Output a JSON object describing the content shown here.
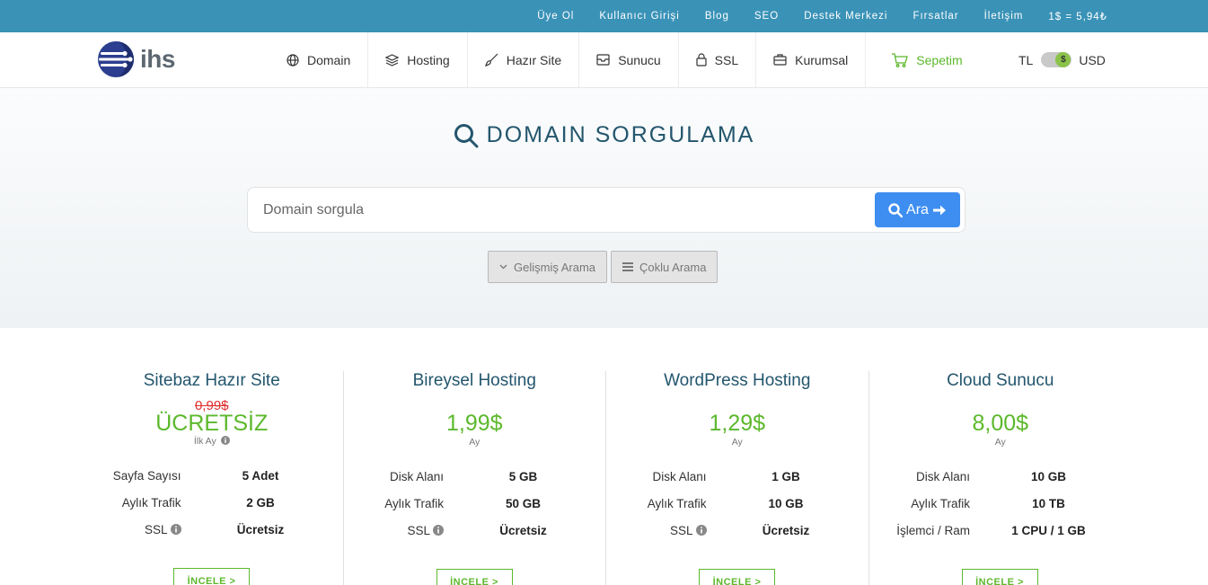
{
  "topbar": {
    "links": [
      "Üye Ol",
      "Kullanıcı Girişi",
      "Blog",
      "SEO",
      "Destek Merkezi",
      "Fırsatlar",
      "İletişim"
    ],
    "exchange_rate": "1$ = 5,94₺"
  },
  "header": {
    "logo_text": "ihs",
    "nav": [
      {
        "label": "Domain",
        "icon": "globe-icon"
      },
      {
        "label": "Hosting",
        "icon": "layers-icon"
      },
      {
        "label": "Hazır Site",
        "icon": "brush-icon"
      },
      {
        "label": "Sunucu",
        "icon": "server-icon"
      },
      {
        "label": "SSL",
        "icon": "lock-icon"
      },
      {
        "label": "Kurumsal",
        "icon": "briefcase-icon"
      }
    ],
    "cart_label": "Sepetim",
    "currency": {
      "left": "TL",
      "right": "USD",
      "knob": "$",
      "active": "USD"
    },
    "colors": {
      "topbar": "#3a92b7",
      "accent_green": "#5cb82c"
    }
  },
  "hero": {
    "title": "DOMAIN SORGULAMA",
    "search_placeholder": "Domain sorgula",
    "search_value": "",
    "search_button": "Ara",
    "options": [
      "Gelişmiş Arama",
      "Çoklu Arama"
    ],
    "colors": {
      "button": "#3d8ef0",
      "title": "#23566d"
    }
  },
  "products": [
    {
      "title": "Sitebaz Hazır Site",
      "old_price": "0,99$",
      "price": "ÜCRETSİZ",
      "period": "İlk Ay",
      "specs": [
        {
          "label": "Sayfa Sayısı",
          "value": "5 Adet"
        },
        {
          "label": "Aylık Trafik",
          "value": "2 GB"
        },
        {
          "label": "SSL",
          "value": "Ücretsiz",
          "info": true
        }
      ],
      "button": "İNCELE >"
    },
    {
      "title": "Bireysel Hosting",
      "old_price": "",
      "price": "1,99$",
      "period": "Ay",
      "specs": [
        {
          "label": "Disk Alanı",
          "value": "5 GB"
        },
        {
          "label": "Aylık Trafik",
          "value": "50 GB"
        },
        {
          "label": "SSL",
          "value": "Ücretsiz",
          "info": true
        }
      ],
      "button": "İNCELE >"
    },
    {
      "title": "WordPress Hosting",
      "old_price": "",
      "price": "1,29$",
      "period": "Ay",
      "specs": [
        {
          "label": "Disk Alanı",
          "value": "1 GB"
        },
        {
          "label": "Aylık Trafik",
          "value": "10 GB"
        },
        {
          "label": "SSL",
          "value": "Ücretsiz",
          "info": true
        }
      ],
      "button": "İNCELE >"
    },
    {
      "title": "Cloud Sunucu",
      "old_price": "",
      "price": "8,00$",
      "period": "Ay",
      "specs": [
        {
          "label": "Disk Alanı",
          "value": "10 GB"
        },
        {
          "label": "Aylık Trafik",
          "value": "10 TB"
        },
        {
          "label": "İşlemci / Ram",
          "value": "1 CPU / 1 GB"
        }
      ],
      "button": "İNCELE >"
    }
  ]
}
